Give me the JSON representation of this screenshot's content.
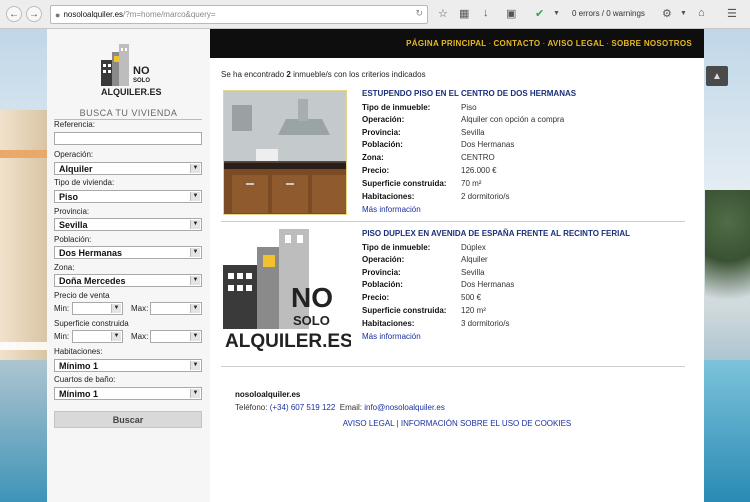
{
  "browser": {
    "url_host": "nosoloalquiler.es",
    "url_path": "/?m=home/marco&query=",
    "errors_text": "0 errors / 0 warnings"
  },
  "logo": {
    "line1": "NO",
    "line2": "SOLO",
    "line3": "ALQUILER.ES"
  },
  "sidebar": {
    "title": "BUSCA TU VIVIENDA",
    "referencia_label": "Referencia:",
    "referencia_value": "",
    "operacion_label": "Operación:",
    "operacion_value": "Alquiler",
    "tipo_label": "Tipo de vivienda:",
    "tipo_value": "Piso",
    "provincia_label": "Provincia:",
    "provincia_value": "Sevilla",
    "poblacion_label": "Población:",
    "poblacion_value": "Dos Hermanas",
    "zona_label": "Zona:",
    "zona_value": "Doña Mercedes",
    "precio_label": "Precio de venta",
    "superficie_label": "Superficie construida",
    "min_label": "Min:",
    "max_label": "Max:",
    "habitaciones_label": "Habitaciones:",
    "habitaciones_value": "Mínimo 1",
    "banos_label": "Cuartos de baño:",
    "banos_value": "Mínimo 1",
    "buscar": "Buscar"
  },
  "nav": {
    "items": [
      "PÁGINA PRINCIPAL",
      "CONTACTO",
      "AVISO LEGAL",
      "SOBRE NOSOTROS"
    ],
    "separator": "·"
  },
  "results": {
    "prefix": "Se ha encontrado ",
    "count": "2",
    "suffix": " inmueble/s con los criterios indicados"
  },
  "fields": [
    "Tipo de inmueble:",
    "Operación:",
    "Provincia:",
    "Población:",
    "Zona:",
    "Precio:",
    "Superficie construida:",
    "Habitaciones:"
  ],
  "listings": [
    {
      "title": "ESTUPENDO PISO EN EL CENTRO DE DOS HERMANAS",
      "tipo": "Piso",
      "operacion": "Alquiler con opción a compra",
      "provincia": "Sevilla",
      "poblacion": "Dos Hermanas",
      "zona": "CENTRO",
      "precio": "126.000 €",
      "superficie": "70 m²",
      "habitaciones": "2 dormitorio/s",
      "more": "Más información"
    },
    {
      "title": "PISO DUPLEX EN AVENIDA DE ESPAÑA FRENTE AL RECINTO FERIAL",
      "tipo": "Dúplex",
      "operacion": "Alquiler",
      "provincia": "Sevilla",
      "poblacion": "Dos Hermanas",
      "precio": "500 €",
      "superficie": "120 m²",
      "habitaciones": "3 dormitorio/s",
      "more": "Más información"
    }
  ],
  "footer": {
    "name": "nosoloalquiler.es",
    "phone_label": "Teléfono:",
    "phone": "(+34) 607 519 122",
    "email_label": "Email:",
    "email": "info@nosoloalquiler.es",
    "aviso": "AVISO LEGAL",
    "sep": "|",
    "cookies": "INFORMACIÓN SOBRE EL USO DE COOKIES"
  },
  "colors": {
    "nav_bg": "#0e0e0e",
    "nav_text": "#e8b824",
    "title_blue": "#1a2f7a",
    "link_blue": "#1a2fa0"
  }
}
